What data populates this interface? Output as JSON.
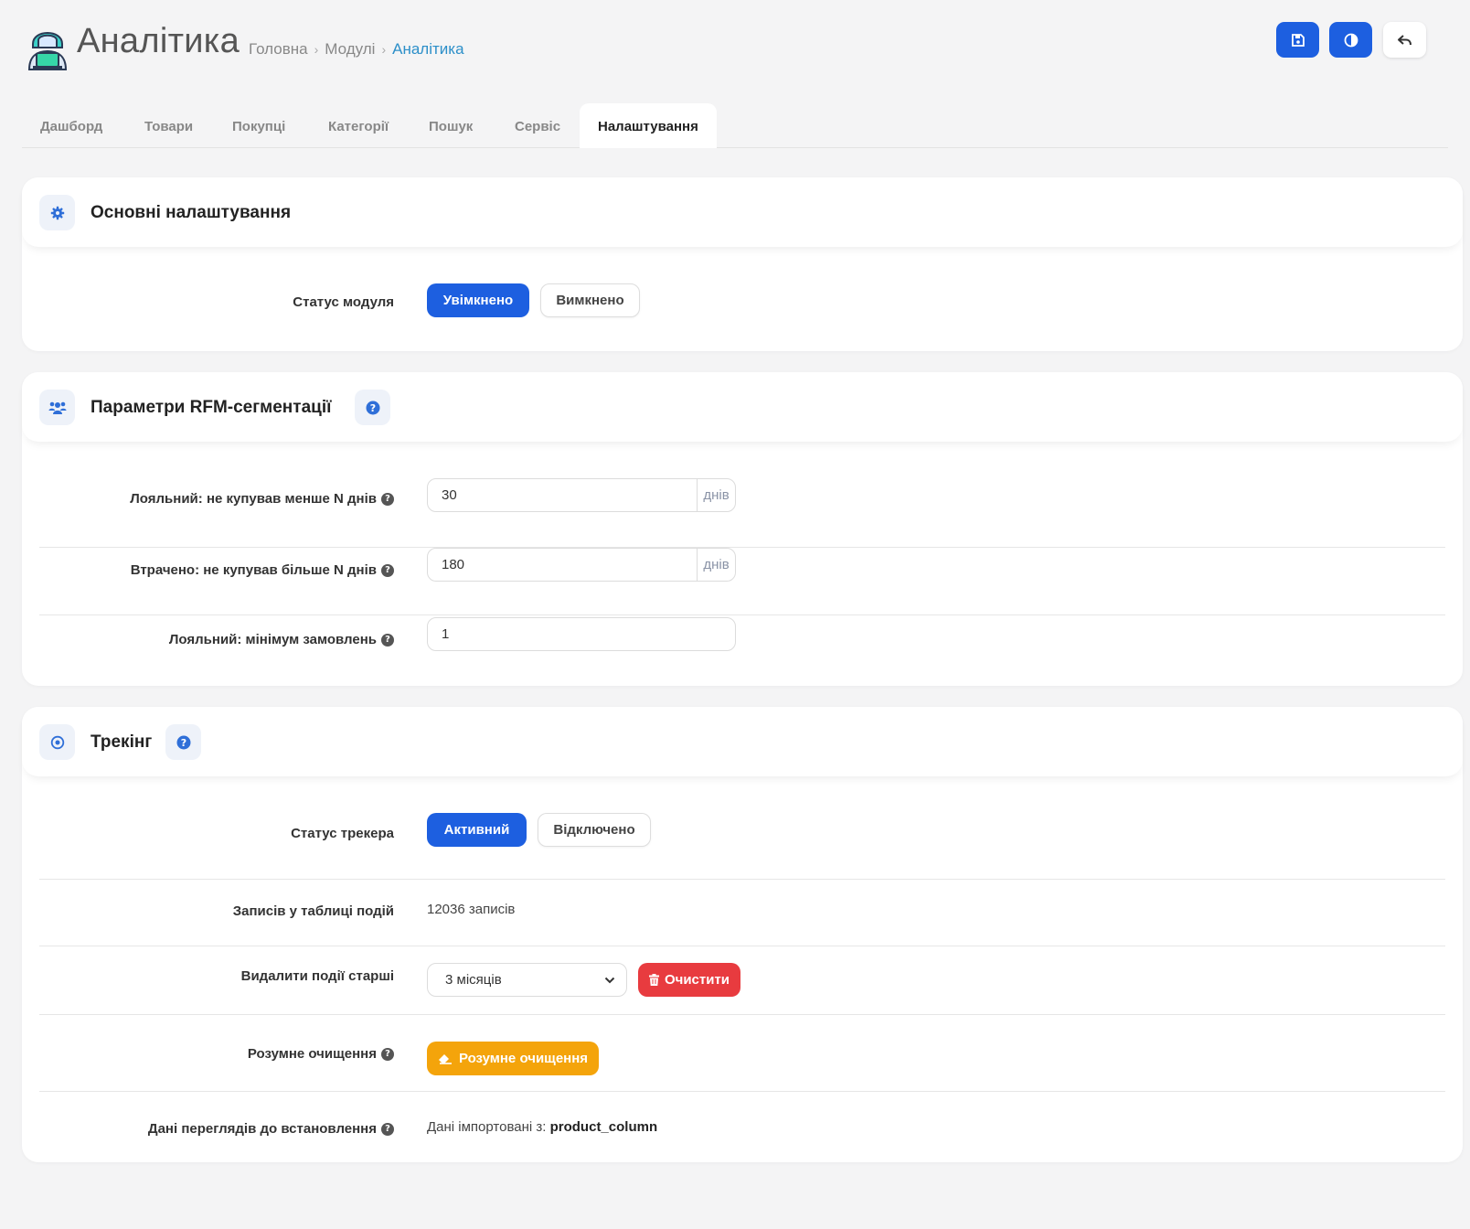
{
  "header": {
    "title": "Аналітика",
    "breadcrumb": [
      "Головна",
      "Модулі",
      "Аналітика"
    ],
    "buttons": {
      "save_icon": "save-icon",
      "contrast_icon": "contrast-icon",
      "back_icon": "back-arrow-icon"
    }
  },
  "tabs": [
    {
      "label": "Дашборд"
    },
    {
      "label": "Товари"
    },
    {
      "label": "Покупці"
    },
    {
      "label": "Категорії"
    },
    {
      "label": "Пошук"
    },
    {
      "label": "Сервіс"
    },
    {
      "label": "Налаштування",
      "active": true
    }
  ],
  "basic": {
    "title": "Основні налаштування",
    "status_label": "Статус модуля",
    "on_label": "Увімкнено",
    "off_label": "Вимкнено"
  },
  "rfm": {
    "title": "Параметри RFM-сегментації",
    "loyal_days_label": "Лояльний: не купував менше N днів",
    "loyal_days_value": "30",
    "lost_days_label": "Втрачено: не купував більше N днів",
    "lost_days_value": "180",
    "days_unit": "днів",
    "loyal_orders_label": "Лояльний: мінімум замовлень",
    "loyal_orders_value": "1"
  },
  "tracking": {
    "title": "Трекінг",
    "tracker_status_label": "Статус трекера",
    "active_label": "Активний",
    "disabled_label": "Відключено",
    "records_label": "Записів у таблиці подій",
    "records_value": "12036 записів",
    "delete_label": "Видалити події старші",
    "delete_select_value": "3 місяців",
    "clear_button": "Очистити",
    "smart_label": "Розумне очищення",
    "smart_button": "Розумне очищення",
    "views_label": "Дані переглядів до встановлення",
    "views_prefix": "Дані імпортовані з:",
    "views_source": "product_column"
  },
  "colors": {
    "primary": "#1d5fe0",
    "danger": "#e83b3f",
    "warning": "#f4a40b",
    "breadcrumb_active": "#2c8fc9",
    "background": "#f4f4f5"
  }
}
